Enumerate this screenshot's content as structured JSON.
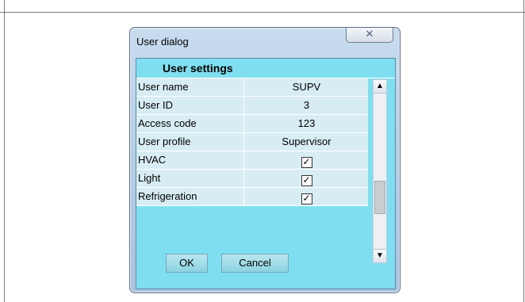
{
  "window": {
    "title": "User dialog",
    "close_symbol": "✕",
    "section_title": "User settings"
  },
  "rows": [
    {
      "label": "User name",
      "value": "SUPV",
      "type": "text"
    },
    {
      "label": "User ID",
      "value": "3",
      "type": "text"
    },
    {
      "label": "Access code",
      "value": "123",
      "type": "text"
    },
    {
      "label": "User profile",
      "value": "Supervisor",
      "type": "text"
    },
    {
      "label": "HVAC",
      "checked": true,
      "type": "checkbox",
      "checkmark": "✓"
    },
    {
      "label": "Light",
      "checked": true,
      "type": "checkbox",
      "checkmark": "✓"
    },
    {
      "label": "Refrigeration",
      "checked": true,
      "type": "checkbox",
      "checkmark": "✓"
    }
  ],
  "scrollbar": {
    "up_symbol": "▲",
    "down_symbol": "▼"
  },
  "buttons": {
    "ok": "OK",
    "cancel": "Cancel"
  },
  "colors": {
    "client_bg": "#7fdff0",
    "row_bg": "#d7edf3"
  }
}
